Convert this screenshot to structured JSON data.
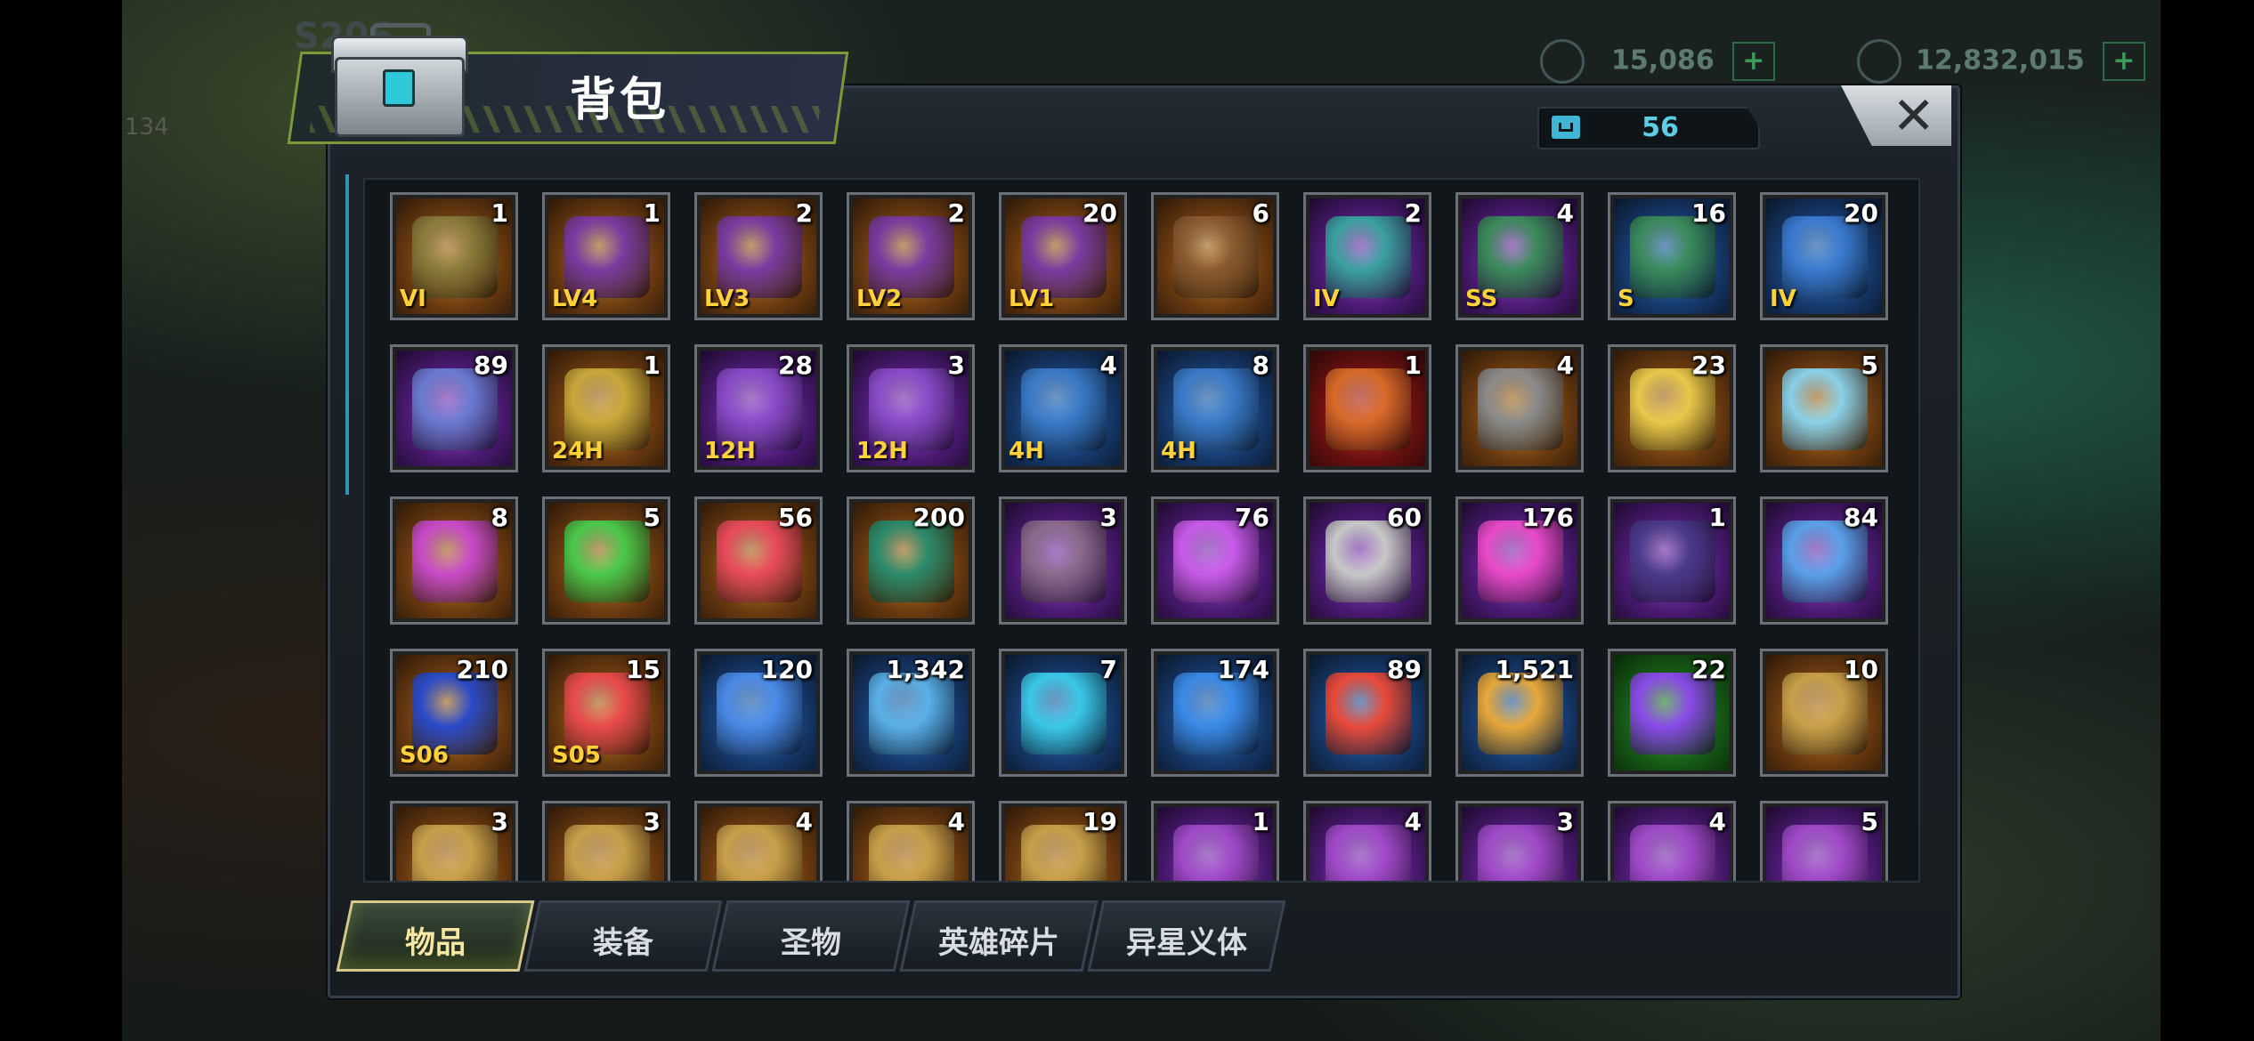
{
  "background": {
    "server_label": "S206",
    "level_label": "134",
    "resource_1": {
      "value": "15,086",
      "plus": "+"
    },
    "resource_2": {
      "value": "12,832,015",
      "plus": "+"
    }
  },
  "header": {
    "title": "背包",
    "close_label": "✕",
    "capacity_value": "56"
  },
  "tabs": [
    {
      "label": "物品",
      "active": true
    },
    {
      "label": "装备",
      "active": false
    },
    {
      "label": "圣物",
      "active": false
    },
    {
      "label": "英雄碎片",
      "active": false
    },
    {
      "label": "异星义体",
      "active": false
    }
  ],
  "items": [
    [
      {
        "icon": "gold-chest-vi-icon",
        "count": "1",
        "quality": "gold",
        "tag": "VI",
        "art": "#8a7a3a"
      },
      {
        "icon": "crystal-chest-lv4-icon",
        "count": "1",
        "quality": "gold",
        "tag": "LV4",
        "art": "#7a3aa0"
      },
      {
        "icon": "crystal-chest-lv3-icon",
        "count": "2",
        "quality": "gold",
        "tag": "LV3",
        "art": "#7a3aa0"
      },
      {
        "icon": "crystal-chest-lv2-icon",
        "count": "2",
        "quality": "gold",
        "tag": "LV2",
        "art": "#7a3aa0"
      },
      {
        "icon": "crystal-chest-lv1-icon",
        "count": "20",
        "quality": "gold",
        "tag": "LV1",
        "art": "#7a3aa0"
      },
      {
        "icon": "bronze-chest-icon",
        "count": "6",
        "quality": "gold",
        "tag": "",
        "art": "#8a5a30"
      },
      {
        "icon": "purple-chest-iv-icon",
        "count": "2",
        "quality": "purple",
        "tag": "IV",
        "art": "#3aa0a0"
      },
      {
        "icon": "chained-chest-ss-icon",
        "count": "4",
        "quality": "purple",
        "tag": "SS",
        "art": "#3a8a5a"
      },
      {
        "icon": "chained-chest-s-icon",
        "count": "16",
        "quality": "blue",
        "tag": "S",
        "art": "#3a8a5a"
      },
      {
        "icon": "blue-chest-iv-icon",
        "count": "20",
        "quality": "blue",
        "tag": "IV",
        "art": "#3a7ad0"
      }
    ],
    [
      {
        "icon": "speedup-device-icon",
        "count": "89",
        "quality": "purple",
        "tag": "",
        "art": "#6a7ad0"
      },
      {
        "icon": "speedup-card-24h-icon",
        "count": "1",
        "quality": "gold",
        "tag": "24H",
        "art": "#c8a83a"
      },
      {
        "icon": "speedup-card-12h-icon",
        "count": "28",
        "quality": "purple",
        "tag": "12H",
        "art": "#8a4ac8"
      },
      {
        "icon": "gold-speedup-card-12h-icon",
        "count": "3",
        "quality": "purple",
        "tag": "12H",
        "art": "#8a4ac8"
      },
      {
        "icon": "speedup-card-4h-icon",
        "count": "4",
        "quality": "blue",
        "tag": "4H",
        "art": "#3a7ac8"
      },
      {
        "icon": "gold-speedup-card-4h-icon",
        "count": "8",
        "quality": "blue",
        "tag": "4H",
        "art": "#3a7ac8"
      },
      {
        "icon": "red-cube-icon",
        "count": "1",
        "quality": "red",
        "tag": "",
        "art": "#d86a2a"
      },
      {
        "icon": "silver-cube-icon",
        "count": "4",
        "quality": "gold",
        "tag": "",
        "art": "#8a8a8a"
      },
      {
        "icon": "gold-feather-icon",
        "count": "23",
        "quality": "gold",
        "tag": "",
        "art": "#e8c84a"
      },
      {
        "icon": "crystal-shard-icon",
        "count": "5",
        "quality": "gold",
        "tag": "",
        "art": "#8ad0e8"
      }
    ],
    [
      {
        "icon": "purple-mask-icon",
        "count": "8",
        "quality": "gold",
        "tag": "",
        "art": "#c84ac8"
      },
      {
        "icon": "green-leaf-icon",
        "count": "5",
        "quality": "gold",
        "tag": "",
        "art": "#4ac84a"
      },
      {
        "icon": "red-orb-icon",
        "count": "56",
        "quality": "gold",
        "tag": "",
        "art": "#e84a5a"
      },
      {
        "icon": "green-coin-stack-icon",
        "count": "200",
        "quality": "gold",
        "tag": "",
        "art": "#2a8a6a"
      },
      {
        "icon": "purple-cube-icon",
        "count": "3",
        "quality": "purple",
        "tag": "",
        "art": "#8a6a8a"
      },
      {
        "icon": "purple-crystal-icon",
        "count": "76",
        "quality": "purple",
        "tag": "",
        "art": "#c85ae8"
      },
      {
        "icon": "film-reel-icon",
        "count": "60",
        "quality": "purple",
        "tag": "",
        "art": "#c8c8c8"
      },
      {
        "icon": "pink-bottle-cap-icon",
        "count": "176",
        "quality": "purple",
        "tag": "",
        "art": "#e84ac8"
      },
      {
        "icon": "poker-chip-spade-icon",
        "count": "1",
        "quality": "purple",
        "tag": "",
        "art": "#4a3a8a"
      },
      {
        "icon": "police-badge-icon",
        "count": "84",
        "quality": "purple",
        "tag": "",
        "art": "#5aa0e8"
      }
    ],
    [
      {
        "icon": "blueberry-icon",
        "count": "210",
        "quality": "gold",
        "tag": "S06",
        "art": "#2a4ac8"
      },
      {
        "icon": "watermelon-icon",
        "count": "15",
        "quality": "gold",
        "tag": "S05",
        "art": "#e84a4a"
      },
      {
        "icon": "blue-crystal-icon",
        "count": "120",
        "quality": "blue",
        "tag": "",
        "art": "#4a8ae8"
      },
      {
        "icon": "cinema-ticket-icon",
        "count": "1,342",
        "quality": "blue",
        "tag": "",
        "art": "#5ab0e8"
      },
      {
        "icon": "timer-disc-icon",
        "count": "7",
        "quality": "blue",
        "tag": "",
        "art": "#3ac8e8"
      },
      {
        "icon": "blue-bottle-cap-icon",
        "count": "174",
        "quality": "blue",
        "tag": "",
        "art": "#3a8ae8"
      },
      {
        "icon": "poker-chip-heart-icon",
        "count": "89",
        "quality": "blue",
        "tag": "",
        "art": "#e84a3a"
      },
      {
        "icon": "bullet-icon",
        "count": "1,521",
        "quality": "blue",
        "tag": "",
        "art": "#e8a83a"
      },
      {
        "icon": "purple-flower-icon",
        "count": "22",
        "quality": "green",
        "tag": "",
        "art": "#8a4ae8"
      },
      {
        "icon": "crossed-swords-card-icon",
        "count": "10",
        "quality": "gold",
        "tag": "",
        "art": "#c8a04a"
      }
    ],
    [
      {
        "icon": "gold-blueprint-icon",
        "count": "3",
        "quality": "gold",
        "tag": "",
        "art": "#c8a04a"
      },
      {
        "icon": "gold-blueprint-icon",
        "count": "3",
        "quality": "gold",
        "tag": "",
        "art": "#c8a04a"
      },
      {
        "icon": "gold-blueprint-icon",
        "count": "4",
        "quality": "gold",
        "tag": "",
        "art": "#c8a04a"
      },
      {
        "icon": "gold-blueprint-icon",
        "count": "4",
        "quality": "gold",
        "tag": "",
        "art": "#c8a04a"
      },
      {
        "icon": "gold-blueprint-icon",
        "count": "19",
        "quality": "gold",
        "tag": "",
        "art": "#c8a04a"
      },
      {
        "icon": "purple-blueprint-icon",
        "count": "1",
        "quality": "purple",
        "tag": "",
        "art": "#a04ac8"
      },
      {
        "icon": "purple-blueprint-icon",
        "count": "4",
        "quality": "purple",
        "tag": "",
        "art": "#a04ac8"
      },
      {
        "icon": "purple-blueprint-icon",
        "count": "3",
        "quality": "purple",
        "tag": "",
        "art": "#a04ac8"
      },
      {
        "icon": "purple-blueprint-icon",
        "count": "4",
        "quality": "purple",
        "tag": "",
        "art": "#a04ac8"
      },
      {
        "icon": "purple-blueprint-icon",
        "count": "5",
        "quality": "purple",
        "tag": "",
        "art": "#a04ac8"
      }
    ]
  ]
}
